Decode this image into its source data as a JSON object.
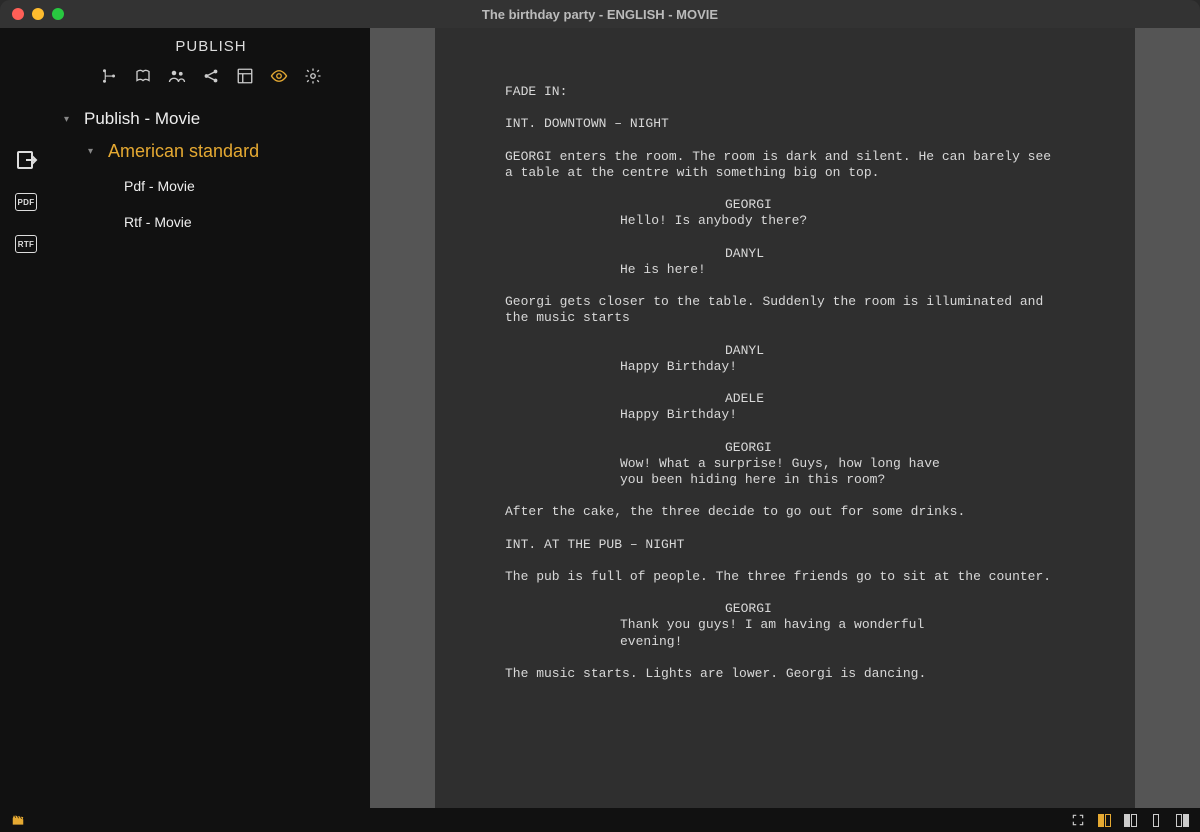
{
  "window": {
    "title": "The birthday party - ENGLISH - MOVIE"
  },
  "sidebar": {
    "title": "PUBLISH",
    "root": {
      "label": "Publish - Movie"
    },
    "group": {
      "label": "American standard"
    },
    "items": [
      {
        "label": "Pdf - Movie"
      },
      {
        "label": "Rtf - Movie"
      }
    ]
  },
  "gutter": {
    "pdf_label": "PDF",
    "rtf_label": "RTF"
  },
  "script": {
    "fade_in": "FADE IN:",
    "scene1": "INT. DOWNTOWN – NIGHT",
    "action1": "GEORGI enters the room. The room is dark and silent. He can barely see a table at the centre with something big on top.",
    "c1": "GEORGI",
    "d1": "Hello! Is anybody there?",
    "c2": "DANYL",
    "d2": "He is here!",
    "action2": "Georgi gets closer to the table. Suddenly the room is illuminated and the music starts",
    "c3": "DANYL",
    "d3": "Happy Birthday!",
    "c4": "ADELE",
    "d4": "Happy Birthday!",
    "c5": "GEORGI",
    "d5": "Wow! What a surprise! Guys, how long have you been hiding here in this room?",
    "action3": "After the cake, the three decide to go out for some drinks.",
    "scene2": "INT. AT THE PUB – NIGHT",
    "action4": "The pub is full of people. The three friends go to sit at the counter.",
    "c6": "GEORGI",
    "d6": "Thank you guys! I am having a wonderful evening!",
    "action5": "The music starts. Lights are lower. Georgi is dancing."
  }
}
